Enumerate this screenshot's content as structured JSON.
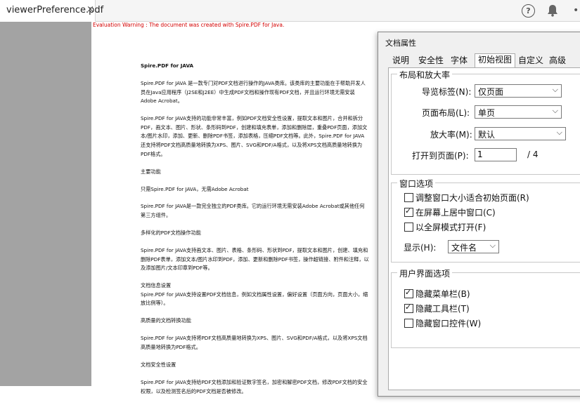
{
  "app": {
    "tab_title": "viewerPreference.pdf",
    "tab_close": "×",
    "more": "•"
  },
  "document": {
    "warning": "Evaluation Warning : The document was created with Spire.PDF for Java.",
    "paragraphs": [
      {
        "text": "Spire.PDF for JAVA",
        "bold": true
      },
      {
        "text": "Spire.PDF for JAVA 是一款专门对PDF文档进行操作的JAVA类库。该类库的主要功能在于帮助开发人员在Java应用程序（J2SE和J2EE）中生成PDF文档和操作现有PDF文档，并且运行环境无需安装Adobe Acrobat。",
        "bold": false
      },
      {
        "text": "Spire.PDF for JAVA支持的功能非常丰富，例如PDF文档安全性设置，提取文本和图片，合并和拆分PDF，画文本、图片、形状、条形码到PDF，创建和填充表单，添加和删除层，重叠PDF页面，添加文本/图片水印，添加、更新、删除PDF书签，添加表格，压缩PDF文档等。此外，Spire.PDF for JAVA还支持将PDF文档高质量地转换为XPS、图片、SVG和PDF/A格式，以及将XPS文档高质量地转换为PDF格式。",
        "bold": false
      },
      {
        "text": "主要功能",
        "bold": false
      },
      {
        "text": "只需Spire.PDF for JAVA，无需Adobe Acrobat",
        "bold": false
      },
      {
        "text": "Spire.PDF for JAVA是一款完全独立的PDF类库。它的运行环境无需安装Adobe Acrobat或其他任何第三方组件。",
        "bold": false
      },
      {
        "text": "多样化的PDF文档操作功能",
        "bold": false
      },
      {
        "text": "Spire.PDF for JAVA支持画文本、图片、表格、条形码、形状到PDF，提取文本和图片，创建、填充和删除PDF表单，添加文本/图片水印到PDF，添加、更新和删除PDF书签，操作超链接、附件和注释，以及添加图片/文本印章到PDF等。",
        "bold": false
      },
      {
        "text": "文档信息设置\nSpire.PDF for JAVA支持设置PDF文档信息，例如文档属性设置，偏好设置（页面方向，页面大小，缩放比例等）。",
        "bold": false
      },
      {
        "text": "高质量的文档转换功能",
        "bold": false
      },
      {
        "text": "Spire.PDF for JAVA支持将PDF文档高质量地转换为XPS、图片、SVG和PDF/A格式，以及将XPS文档高质量地转换为PDF格式。",
        "bold": false
      },
      {
        "text": "文档安全性设置",
        "bold": false
      },
      {
        "text": "Spire.PDF for JAVA支持给PDF文档添加和验证数字签名，加密和解密PDF文档，修改PDF文档的安全权限，以及检测签名后的PDF文档是否被修改。",
        "bold": false
      }
    ]
  },
  "dialog": {
    "title": "文档属性",
    "tabs": [
      "说明",
      "安全性",
      "字体",
      "初始视图",
      "自定义",
      "高级"
    ],
    "active_tab": "初始视图",
    "layout_group": {
      "title": "布局和放大率",
      "nav_label": "导览标签(N):",
      "nav_value": "仅页面",
      "page_layout_label": "页面布局(L):",
      "page_layout_value": "单页",
      "zoom_label": "放大率(M):",
      "zoom_value": "默认",
      "open_page_label": "打开到页面(P):",
      "open_page_value": "1",
      "page_total": "/ 4"
    },
    "window_group": {
      "title": "窗口选项",
      "options": [
        {
          "label": "调整窗口大小适合初始页面(R)",
          "checked": false
        },
        {
          "label": "在屏幕上居中窗口(C)",
          "checked": true
        },
        {
          "label": "以全屏模式打开(F)",
          "checked": false
        }
      ],
      "show_label": "显示(H):",
      "show_value": "文件名"
    },
    "ui_group": {
      "title": "用户界面选项",
      "options": [
        {
          "label": "隐藏菜单栏(B)",
          "checked": true
        },
        {
          "label": "隐藏工具栏(T)",
          "checked": true
        },
        {
          "label": "隐藏窗口控件(W)",
          "checked": false
        }
      ]
    }
  }
}
